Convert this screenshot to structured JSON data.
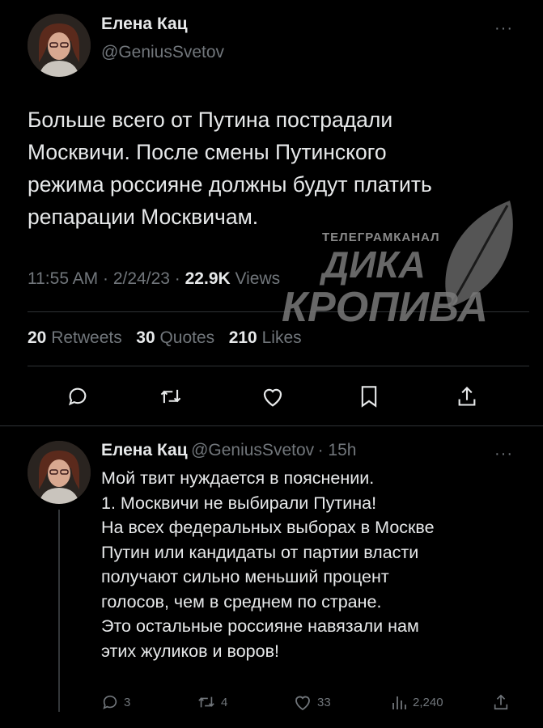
{
  "tweet": {
    "author_name": "Елена Кац",
    "author_handle": "@GeniusSvetov",
    "more_label": "···",
    "text_lines": [
      "Больше всего от Путина пострадали",
      "Москвичи. После смены Путинского",
      "режима россияне должны будут платить",
      "репарации Москвичам."
    ],
    "time": "11:55 AM",
    "date": "2/24/23",
    "separator": "·",
    "views_count": "22.9K",
    "views_label": "Views",
    "retweets_count": "20",
    "retweets_label": "Retweets",
    "quotes_count": "30",
    "quotes_label": "Quotes",
    "likes_count": "210",
    "likes_label": "Likes"
  },
  "reply": {
    "author_name": "Елена Кац",
    "author_handle": "@GeniusSvetov",
    "age": "· 15h",
    "more_label": "···",
    "text_lines": [
      "Мой твит нуждается в пояснении.",
      "1. Москвичи не выбирали Путина!",
      "На всех федеральных выборах в Москве",
      "Путин или кандидаты от партии власти",
      "получают сильно меньший процент",
      "голосов, чем в среднем по стране.",
      "Это остальные россияне навязали нам",
      "этих жуликов и воров!"
    ],
    "replies_count": "3",
    "retweets_count": "4",
    "likes_count": "33",
    "views_count": "2,240"
  },
  "watermark": {
    "line1": "ТЕЛЕГРАМКАНАЛ",
    "line2": "ДИКА",
    "line3": "КРОПИВА"
  },
  "icons": {
    "reply": "comment-icon",
    "retweet": "retweet-icon",
    "like": "heart-icon",
    "bookmark": "bookmark-icon",
    "share": "share-icon",
    "views": "bar-chart-icon",
    "more": "more-dots-icon"
  },
  "colors": {
    "background": "#000000",
    "text": "#e7e9ea",
    "secondary": "#71767b",
    "divider": "#2f3336"
  }
}
